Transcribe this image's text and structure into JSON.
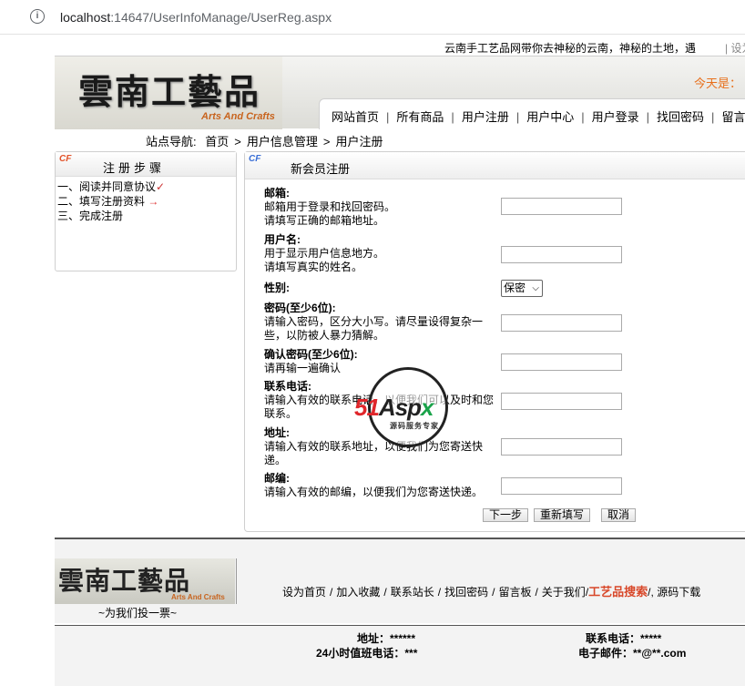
{
  "browser": {
    "url_host": "localhost",
    "url_rest": ":14647/UserInfoManage/UserReg.aspx",
    "info_icon": "info-icon"
  },
  "top": {
    "marquee": "云南手工艺品网带你去神秘的云南，神秘的土地，遇",
    "set_home": "| 设为"
  },
  "header": {
    "logo_title": "雲南工藝品",
    "logo_sub": "Arts And Crafts",
    "today_label": "今天是：",
    "nav": [
      "网站首页",
      "所有商品",
      "用户注册",
      "用户中心",
      "用户登录",
      "找回密码",
      "留言"
    ]
  },
  "breadcrumb": {
    "label": "站点导航:",
    "items": [
      "首页",
      "用户信息管理",
      "用户注册"
    ],
    "arrow": ">"
  },
  "left_panel": {
    "tag": "CF",
    "title": "注册步骤",
    "steps": [
      "一、阅读并同意协议",
      "二、填写注册资料",
      "三、完成注册"
    ],
    "check_mark": "✓",
    "arrow_mark": "→"
  },
  "form": {
    "tag": "CF",
    "title": "新会员注册",
    "fields": [
      {
        "label": "邮箱:",
        "desc1": "邮箱用于登录和找回密码。",
        "desc2": "请填写正确的邮箱地址。"
      },
      {
        "label": "用户名:",
        "desc1": "用于显示用户信息地方。",
        "desc2": "请填写真实的姓名。"
      },
      {
        "label": "性别:",
        "desc1": "",
        "desc2": ""
      },
      {
        "label": "密码(至少6位):",
        "desc1": "请输入密码，区分大小写。请尽量设得复杂一",
        "desc2": "些，以防被人暴力猜解。"
      },
      {
        "label": "确认密码(至少6位):",
        "desc1": "请再输一遍确认",
        "desc2": ""
      },
      {
        "label": "联系电话:",
        "desc1": "请输入有效的联系电话，以便我们可以及时和您",
        "desc2": "联系。"
      },
      {
        "label": "地址:",
        "desc1": "请输入有效的联系地址，以便我们为您寄送快",
        "desc2": "递。"
      },
      {
        "label": "邮编:",
        "desc1": "请输入有效的邮编，以便我们为您寄送快递。",
        "desc2": ""
      }
    ],
    "gender_selected": "保密",
    "buttons": {
      "next": "下一步",
      "reset": "重新填写",
      "cancel": "取消"
    }
  },
  "watermark": {
    "part1": "51",
    "part2": "Asp",
    "part3": "x",
    "sub": "源码服务专家"
  },
  "footer": {
    "logo_title": "雲南工藝品",
    "logo_sub": "Arts And Crafts",
    "vote": "~为我们投一票~",
    "links": [
      "设为首页",
      "加入收藏",
      "联系站长",
      "找回密码",
      "留言板",
      "关于我们"
    ],
    "craft_search": "工艺品搜索",
    "last_link": "源码下载",
    "address": "地址：******",
    "phone": "联系电话：*****",
    "hotline": "24小时值班电话：***",
    "email": "电子邮件：**@**.com"
  }
}
